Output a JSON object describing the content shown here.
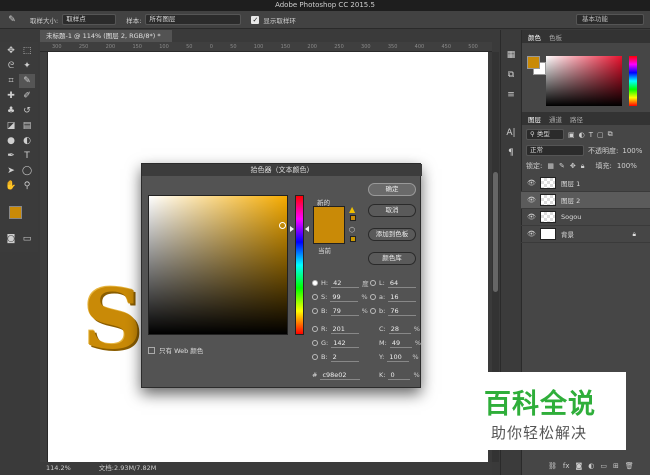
{
  "app": {
    "title": "Adobe Photoshop CC 2015.5"
  },
  "options_bar": {
    "sample_size_label": "取样大小:",
    "sample_size_value": "取样点",
    "sample_label": "样本:",
    "sample_value": "所有图层",
    "show_ring_label": "显示取样环",
    "workspace": "基本功能"
  },
  "document": {
    "tab_label": "未标题-1 @ 114% (图层 2, RGB/8*) *",
    "ruler_ticks": [
      "300",
      "250",
      "200",
      "150",
      "100",
      "50",
      "0",
      "50",
      "100",
      "150",
      "200",
      "250",
      "300",
      "350",
      "400",
      "450",
      "500"
    ],
    "zoom": "114.2%",
    "doc_size": "文档:2.93M/7.82M"
  },
  "canvas": {
    "logo_letter": "S"
  },
  "color_panel": {
    "tabs": [
      "颜色",
      "色板"
    ],
    "fg_color": "#c98a07",
    "hue_color": "#e8122e"
  },
  "layers_panel": {
    "tabs": [
      "图层",
      "通道",
      "路径"
    ],
    "filter_label": "类型",
    "blend_mode": "正常",
    "opacity_label": "不透明度:",
    "opacity_value": "100%",
    "lock_label": "锁定:",
    "fill_label": "填充:",
    "fill_value": "100%",
    "layers": [
      {
        "name": "图层 1",
        "selected": false
      },
      {
        "name": "图层 2",
        "selected": true
      },
      {
        "name": "Sogou",
        "selected": false
      },
      {
        "name": "背景",
        "selected": false
      }
    ]
  },
  "color_picker": {
    "title": "拾色器（文本颜色）",
    "new_label": "新的",
    "current_label": "当前",
    "buttons": {
      "ok": "确定",
      "cancel": "取消",
      "add_swatch": "添加到色板",
      "color_library": "颜色库"
    },
    "fields": {
      "H": "42",
      "H_unit": "度",
      "S": "99",
      "S_unit": "%",
      "B": "79",
      "B_unit": "%",
      "R": "201",
      "G": "142",
      "B2": "2",
      "L": "64",
      "a": "16",
      "b": "76",
      "C": "28",
      "C_unit": "%",
      "M": "49",
      "M_unit": "%",
      "Y": "100",
      "Y_unit": "%",
      "K": "0",
      "K_unit": "%"
    },
    "labels": {
      "H": "H:",
      "S": "S:",
      "B": "B:",
      "R": "R:",
      "G": "G:",
      "B2": "B:",
      "L": "L:",
      "a": "a:",
      "b": "b:",
      "C": "C:",
      "M": "M:",
      "Y": "Y:",
      "K": "K:"
    },
    "hex_label": "#",
    "hex": "c98e02",
    "only_web_label": "只有 Web 颜色",
    "color": "#c98a07",
    "hue_color": "#f5ab00"
  },
  "watermark": {
    "main": "百科全说",
    "sub": "助你轻松解决"
  }
}
